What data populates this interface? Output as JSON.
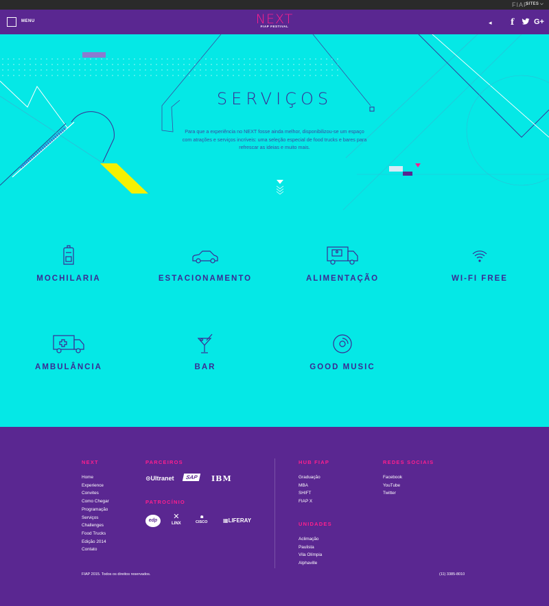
{
  "topbar": {
    "brand": "FIAP",
    "sites": "SITES"
  },
  "header": {
    "menu_label": "MENU",
    "logo_text": "NEXT",
    "logo_sub": "FIAP FESTIVAL"
  },
  "hero": {
    "title": "SERVIÇOS",
    "text": "Para que a experiência no NEXT fosse ainda melhor, disponibilizou-se um espaço com atrações e serviços incríveis: uma seleção especial de food trucks e bares para refrescar as ideias e muito mais."
  },
  "services": [
    {
      "label": "MOCHILARIA",
      "icon": "backpack-icon"
    },
    {
      "label": "ESTACIONAMENTO",
      "icon": "car-icon"
    },
    {
      "label": "ALIMENTAÇÃO",
      "icon": "food-truck-icon"
    },
    {
      "label": "WI-FI FREE",
      "icon": "wifi-icon"
    },
    {
      "label": "AMBULÂNCIA",
      "icon": "ambulance-icon"
    },
    {
      "label": "BAR",
      "icon": "cocktail-icon"
    },
    {
      "label": "GOOD MUSIC",
      "icon": "vinyl-icon"
    }
  ],
  "footer": {
    "next": {
      "title": "NEXT",
      "links": [
        "Home",
        "Experience",
        "Convites",
        "Como Chegar",
        "Programação",
        "Serviços",
        "Challenges",
        "Food Trucks",
        "Edição 2014",
        "Contato"
      ]
    },
    "partners": {
      "title": "PARCEIROS",
      "logos": [
        "Ultranet",
        "SAP",
        "IBM"
      ]
    },
    "sponsorship": {
      "title": "PATROCÍNIO",
      "logos": [
        "edp",
        "LINX",
        "CISCO",
        "LIFERAY"
      ]
    },
    "hub": {
      "title": "HUB FIAP",
      "links": [
        "Graduação",
        "MBA",
        "SHIFT",
        "FIAP X"
      ]
    },
    "units": {
      "title": "UNIDADES",
      "links": [
        "Aclimação",
        "Paulista",
        "Vila Olímpia",
        "Alphaville"
      ]
    },
    "social": {
      "title": "REDES SOCIAIS",
      "links": [
        "Facebook",
        "YouTube",
        "Twitter"
      ]
    },
    "copyright": "FIAP 2015. Todos os direitos reservados.",
    "phone": "(11) 3385-8010"
  },
  "colors": {
    "purple": "#5a2791",
    "cyan": "#05e8e6",
    "pink": "#ff1f8e",
    "navy": "#3b2a93",
    "yellow": "#f6f000"
  }
}
